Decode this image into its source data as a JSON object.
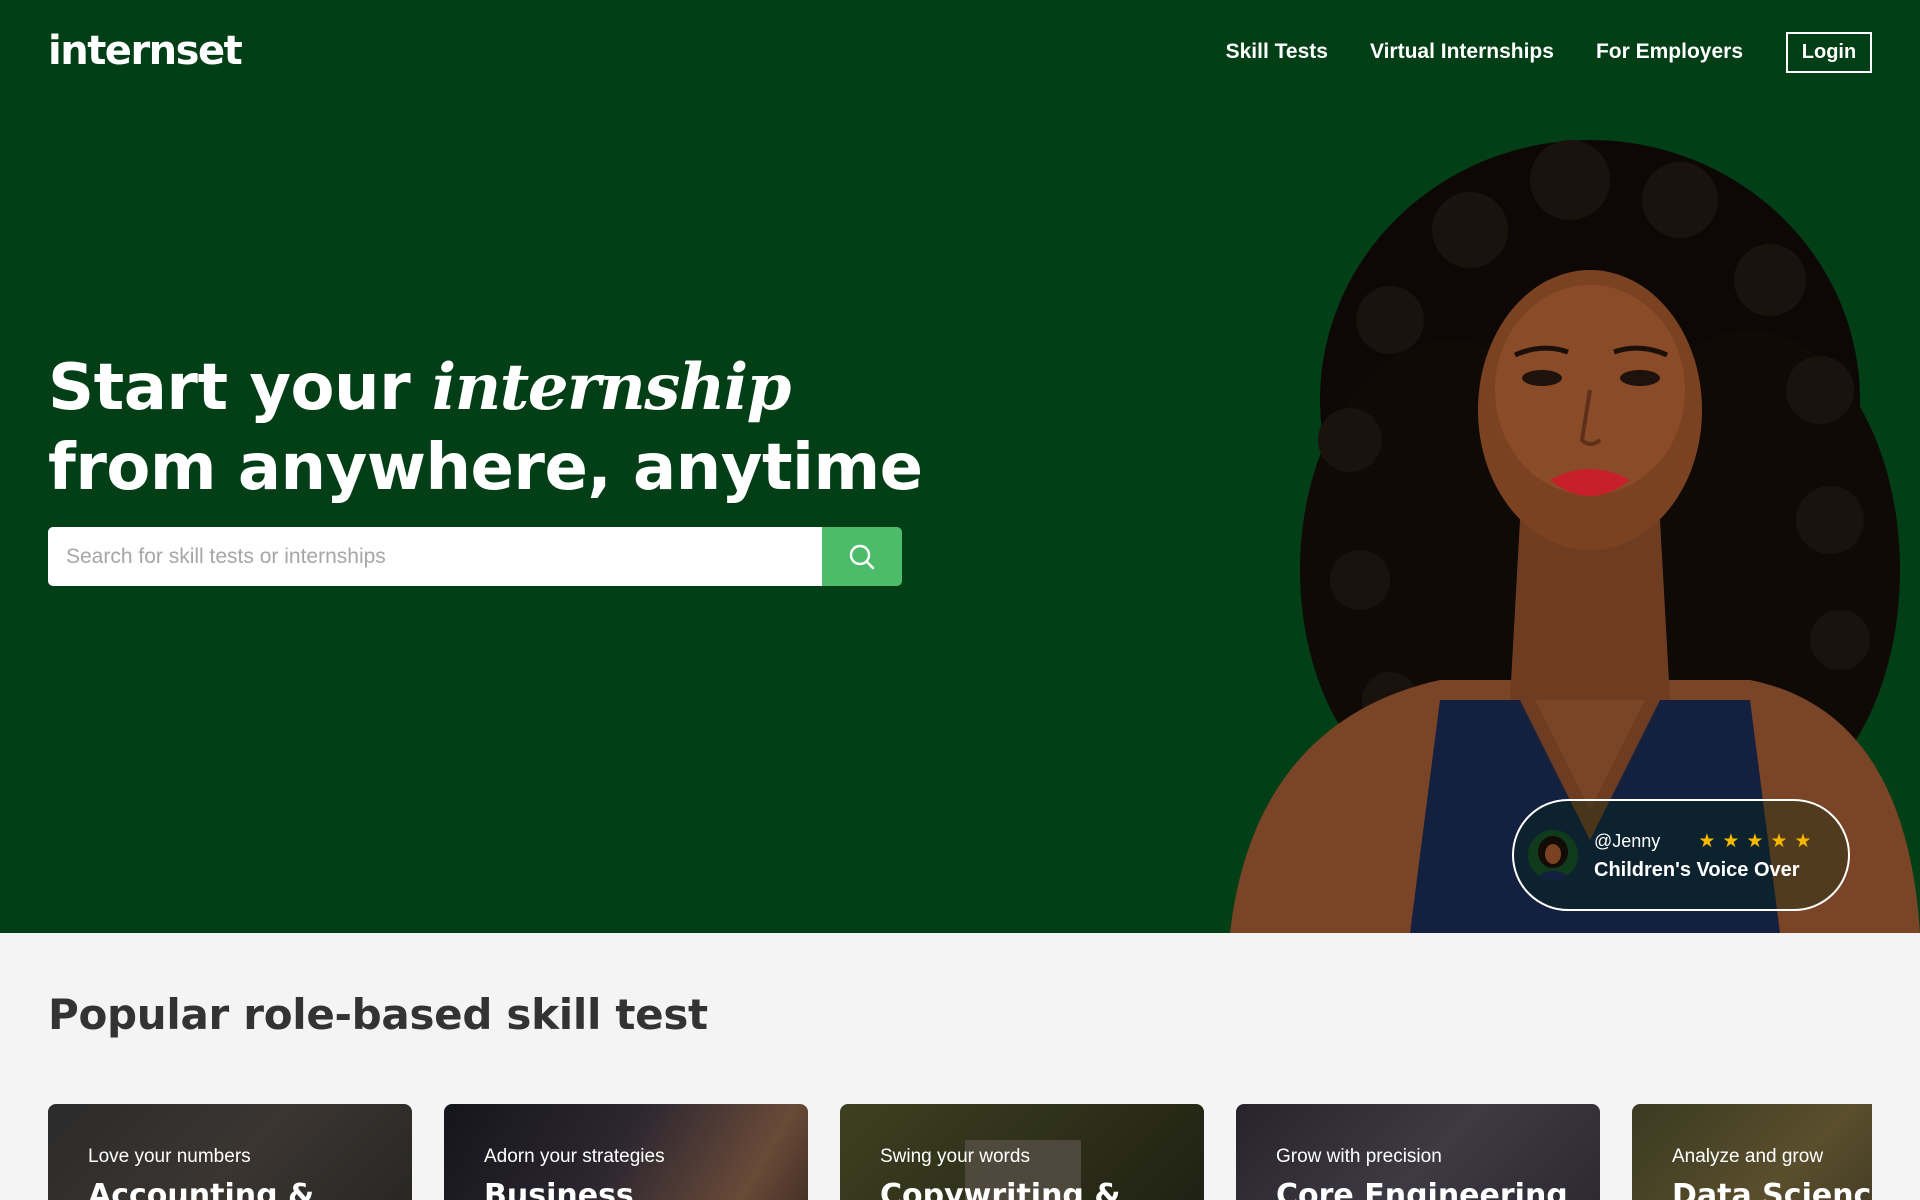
{
  "brand": {
    "logo_text": "internset"
  },
  "nav": {
    "links": [
      "Skill Tests",
      "Virtual Internships",
      "For Employers"
    ],
    "login_label": "Login"
  },
  "hero": {
    "headline_part1": "Start your ",
    "headline_italic": "internship",
    "headline_part2": " from anywhere, anytime",
    "search_placeholder": "Search for skill tests or internships",
    "background_color": "#023e16",
    "accent_color": "#4cbc6b"
  },
  "review": {
    "user": "@Jenny",
    "rating": 5,
    "title": "Children's Voice Over"
  },
  "skills_section": {
    "title": "Popular role-based skill test",
    "cards": [
      {
        "subtitle": "Love your numbers",
        "title": "Accounting &"
      },
      {
        "subtitle": "Adorn your strategies",
        "title": "Business"
      },
      {
        "subtitle": "Swing your words",
        "title": "Copywriting &"
      },
      {
        "subtitle": "Grow with precision",
        "title": "Core Engineering"
      },
      {
        "subtitle": "Analyze and grow",
        "title": "Data Science"
      }
    ]
  }
}
